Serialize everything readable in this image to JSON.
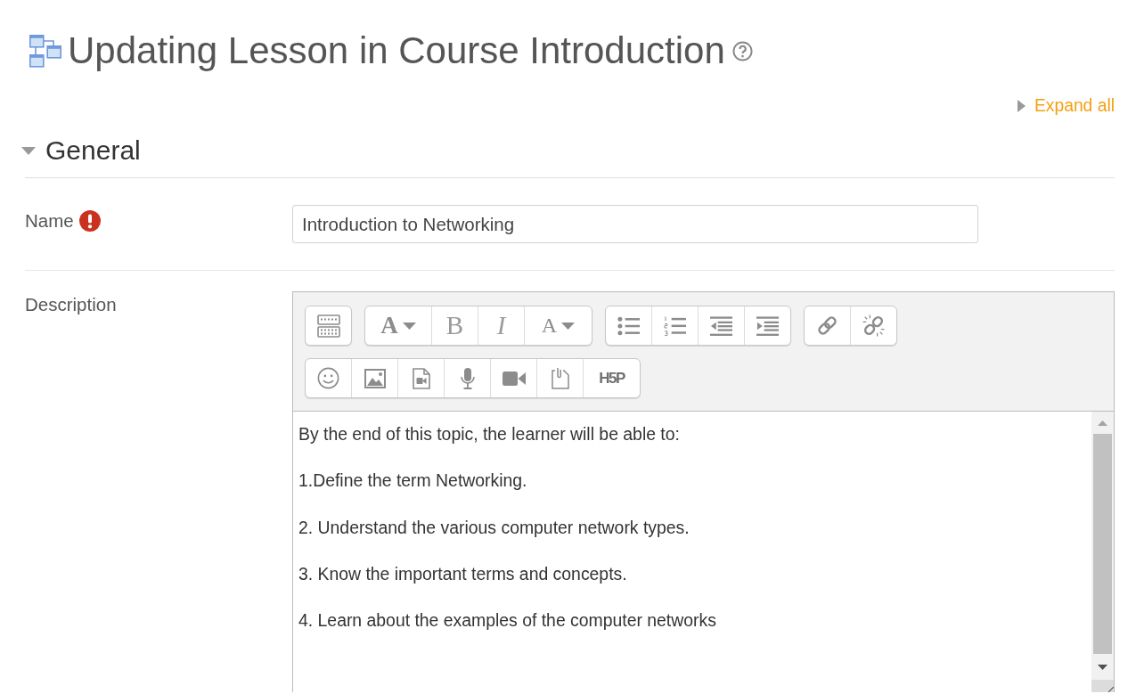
{
  "heading": {
    "title": "Updating Lesson in Course Introduction"
  },
  "expand_all": "Expand all",
  "section": {
    "title": "General",
    "expanded": true,
    "fields": [
      {
        "kind": "text",
        "label": "Name",
        "required": true,
        "value": "Introduction to Networking"
      },
      {
        "kind": "editor",
        "label": "Description",
        "required": false,
        "toolbar": [
          [
            [
              {
                "kind": "toggle",
                "menu": false
              }
            ],
            [
              {
                "kind": "style",
                "glyph": "A",
                "menu": true
              },
              {
                "kind": "bold",
                "glyph": "B",
                "menu": false
              },
              {
                "kind": "italic",
                "glyph": "I",
                "menu": false
              },
              {
                "kind": "color",
                "glyph": "A",
                "menu": true
              }
            ],
            [
              {
                "kind": "bullets",
                "menu": false
              },
              {
                "kind": "numbers",
                "menu": false
              },
              {
                "kind": "outdent",
                "menu": false
              },
              {
                "kind": "indent",
                "menu": false
              }
            ],
            [
              {
                "kind": "link",
                "menu": false
              },
              {
                "kind": "unlink",
                "menu": false
              }
            ]
          ],
          [
            [
              {
                "kind": "emoji",
                "menu": false
              },
              {
                "kind": "image",
                "menu": false
              },
              {
                "kind": "media",
                "menu": false
              },
              {
                "kind": "audio",
                "menu": false
              },
              {
                "kind": "video",
                "menu": false
              },
              {
                "kind": "file",
                "menu": false
              },
              {
                "kind": "logo",
                "glyph": "H5P",
                "menu": false
              }
            ]
          ]
        ],
        "paragraphs": [
          "By the end of this topic, the learner will be able to:",
          "1.Define the term Networking.",
          "2. Understand the various computer network types.",
          "3. Know the important terms and concepts.",
          "4. Learn about the examples of the computer networks"
        ]
      }
    ]
  }
}
